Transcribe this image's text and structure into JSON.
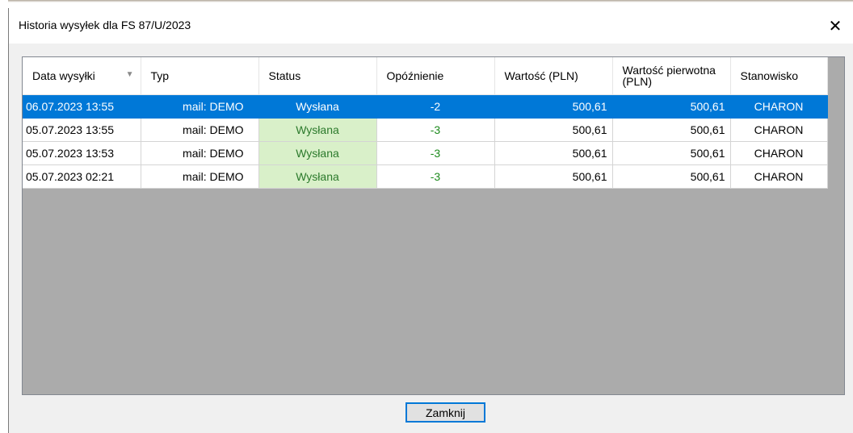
{
  "window": {
    "title": "Historia wysyłek dla FS 87/U/2023",
    "close_glyph": "✕"
  },
  "grid": {
    "columns": [
      "Data wysyłki",
      "Typ",
      "Status",
      "Opóźnienie",
      "Wartość (PLN)",
      "Wartość pierwotna (PLN)",
      "Stanowisko"
    ],
    "sort_indicator": "▼",
    "rows": [
      {
        "date": "06.07.2023 13:55",
        "typ": "mail: DEMO",
        "status": "Wysłana",
        "delay": "-2",
        "value": "500,61",
        "orig": "500,61",
        "station": "CHARON"
      },
      {
        "date": "05.07.2023 13:55",
        "typ": "mail: DEMO",
        "status": "Wysłana",
        "delay": "-3",
        "value": "500,61",
        "orig": "500,61",
        "station": "CHARON"
      },
      {
        "date": "05.07.2023 13:53",
        "typ": "mail: DEMO",
        "status": "Wysłana",
        "delay": "-3",
        "value": "500,61",
        "orig": "500,61",
        "station": "CHARON"
      },
      {
        "date": "05.07.2023 02:21",
        "typ": "mail: DEMO",
        "status": "Wysłana",
        "delay": "-3",
        "value": "500,61",
        "orig": "500,61",
        "station": "CHARON"
      }
    ]
  },
  "footer": {
    "close_label": "Zamknij"
  },
  "colors": {
    "selection": "#0078d7",
    "status_ok_bg": "#d9f0c9",
    "delay_green": "#1c8a1c",
    "empty_area": "#ababab"
  }
}
